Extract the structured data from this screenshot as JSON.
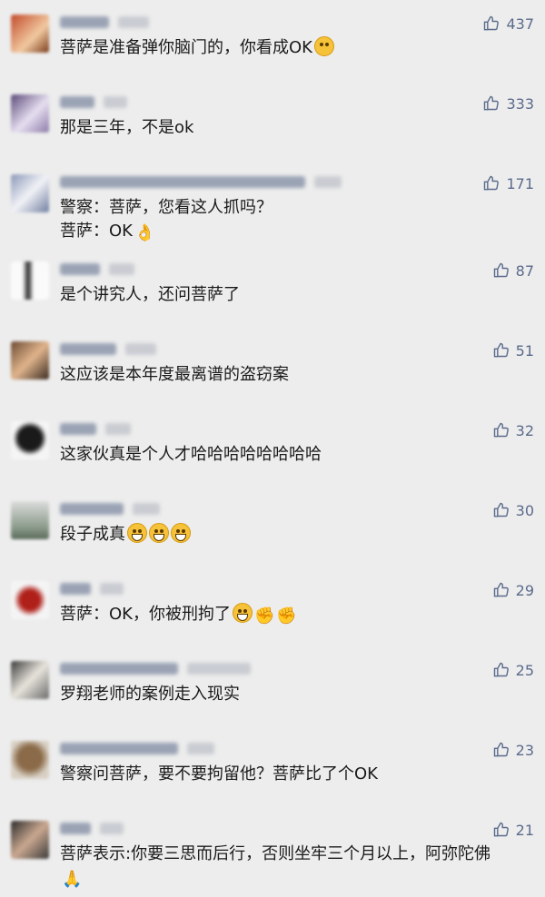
{
  "colors": {
    "background": "#ededed",
    "like": "#5b6b8c",
    "text": "#1a1a1a"
  },
  "like_icon": "thumbs-up-icon",
  "comments": [
    {
      "text": "菩萨是准备弹你脑门的，你看成OK",
      "likes": "437",
      "emoji": [
        "glasses-666-emoji"
      ]
    },
    {
      "text": "那是三年，不是ok",
      "likes": "333",
      "emoji": []
    },
    {
      "text": "警察：菩萨，您看这人抓吗？\n菩萨：OK",
      "likes": "171",
      "emoji": [
        "ok-hand-emoji"
      ]
    },
    {
      "text": "是个讲究人，还问菩萨了",
      "likes": "87",
      "emoji": []
    },
    {
      "text": "这应该是本年度最离谱的盗窃案",
      "likes": "51",
      "emoji": []
    },
    {
      "text": "这家伙真是个人才哈哈哈哈哈哈哈哈",
      "likes": "32",
      "emoji": []
    },
    {
      "text": "段子成真",
      "likes": "30",
      "emoji": [
        "grin-emoji",
        "grin-emoji",
        "grin-emoji"
      ]
    },
    {
      "text": "菩萨：OK，你被刑拘了",
      "likes": "29",
      "emoji": [
        "grin-emoji",
        "fist-emoji",
        "fist-emoji"
      ]
    },
    {
      "text": "罗翔老师的案例走入现实",
      "likes": "25",
      "emoji": []
    },
    {
      "text": "警察问菩萨，要不要拘留他？菩萨比了个OK",
      "likes": "23",
      "emoji": []
    },
    {
      "text": "菩萨表示:你要三思而后行，否则坐牢三个月以上，阿弥陀佛",
      "likes": "21",
      "emoji": [
        "pray-emoji"
      ]
    }
  ]
}
